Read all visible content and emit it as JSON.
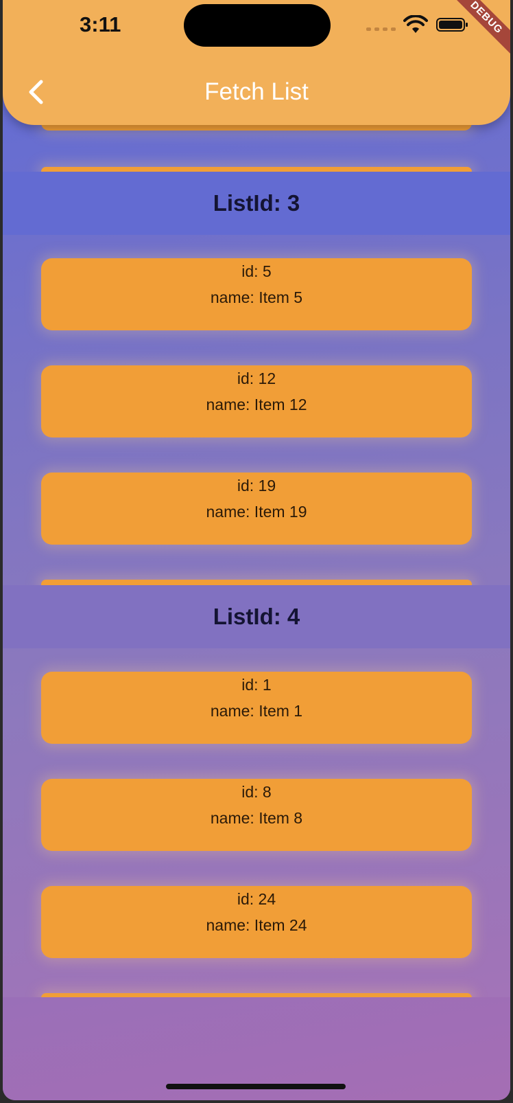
{
  "status": {
    "time": "3:11",
    "debug_label": "DEBUG"
  },
  "appbar": {
    "title": "Fetch List"
  },
  "sections": [
    {
      "header": "ListId: 3",
      "items": [
        {
          "id": "id: 5",
          "name": "name: Item 5"
        },
        {
          "id": "id: 12",
          "name": "name: Item 12"
        },
        {
          "id": "id: 19",
          "name": "name: Item 19"
        }
      ]
    },
    {
      "header": "ListId: 4",
      "items": [
        {
          "id": "id: 1",
          "name": "name: Item 1"
        },
        {
          "id": "id: 8",
          "name": "name: Item 8"
        },
        {
          "id": "id: 24",
          "name": "name: Item 24"
        }
      ]
    }
  ],
  "colors": {
    "appbar": "#f2b059",
    "card": "#f19e37",
    "header_text": "#141433"
  }
}
